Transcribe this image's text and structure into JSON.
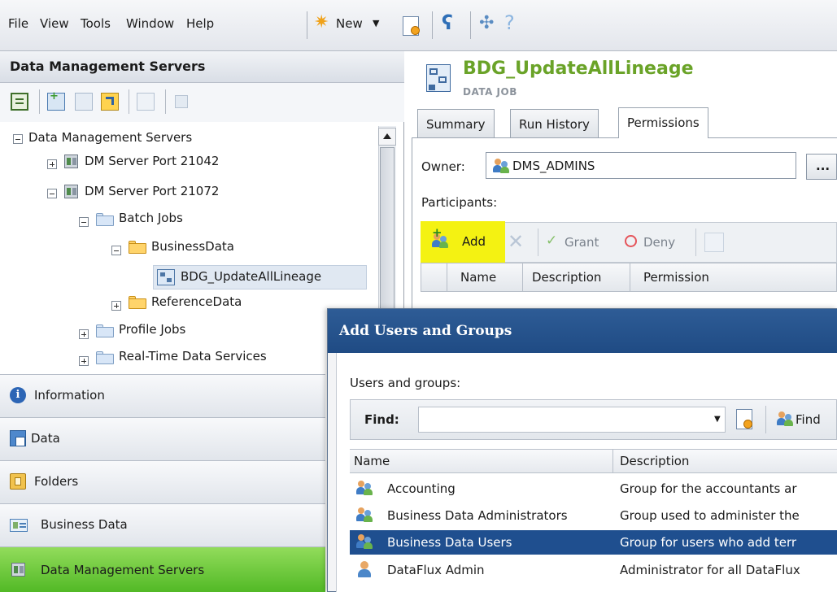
{
  "menu": {
    "items": [
      "File",
      "View",
      "Tools",
      "Window",
      "Help"
    ],
    "new_label": "New"
  },
  "left_pane": {
    "title": "Data Management Servers",
    "tree": {
      "root": "Data Management Servers",
      "server1": "DM Server Port 21042",
      "server2": "DM Server Port 21072",
      "batch_jobs": "Batch Jobs",
      "business_data": "BusinessData",
      "job": "BDG_UpdateAllLineage",
      "reference_data": "ReferenceData",
      "profile_jobs": "Profile Jobs",
      "realtime": "Real-Time Data Services"
    },
    "nav": [
      "Information",
      "Data",
      "Folders",
      "Business Data",
      "Data Management Servers"
    ]
  },
  "job": {
    "title": "BDG_UpdateAllLineage",
    "subtitle": "DATA JOB"
  },
  "tabs": [
    "Summary",
    "Run History",
    "Permissions"
  ],
  "permissions": {
    "owner_label": "Owner:",
    "owner_value": "DMS_ADMINS",
    "browse_label": "...",
    "participants_label": "Participants:",
    "toolbar": {
      "add": "Add",
      "grant": "Grant",
      "deny": "Deny"
    },
    "columns": [
      "Name",
      "Description",
      "Permission"
    ]
  },
  "dialog": {
    "title": "Add Users and Groups",
    "users_label": "Users and groups:",
    "find_label": "Find:",
    "find_button": "Find",
    "columns": [
      "Name",
      "Description"
    ],
    "rows": [
      {
        "name": "Accounting",
        "description": "Group for the accountants ar",
        "icon": "group-icon"
      },
      {
        "name": "Business Data Administrators",
        "description": "Group used to administer the",
        "icon": "group-icon"
      },
      {
        "name": "Business Data Users",
        "description": "Group for users who add terr",
        "icon": "group-icon",
        "selected": true
      },
      {
        "name": "DataFlux Admin",
        "description": "Administrator for all DataFlux",
        "icon": "user-icon"
      }
    ]
  },
  "colors": {
    "job_title": "#6aa328",
    "dialog_title_bar": "#2e5c96",
    "selected_row": "#1f4f8f",
    "active_nav": "#5cbf2e",
    "add_highlight": "#f4f212"
  }
}
